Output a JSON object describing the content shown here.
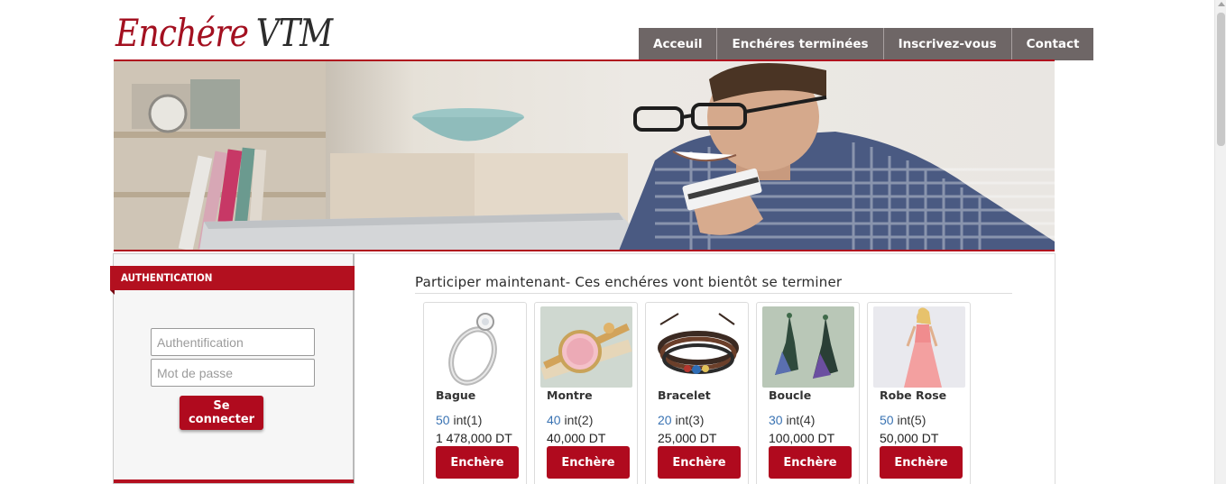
{
  "brand": {
    "logo_part1": "Enchére",
    "logo_part2": "VTM",
    "accent": "#b0101e"
  },
  "nav": {
    "items": [
      {
        "label": "Acceuil"
      },
      {
        "label": "Enchéres terminées"
      },
      {
        "label": "Inscrivez-vous"
      },
      {
        "label": "Contact"
      }
    ]
  },
  "sidebar": {
    "header": "AUTHENTICATION",
    "login_placeholder": "Authentification",
    "password_placeholder": "Mot de passe",
    "submit_label": "Se connecter"
  },
  "main": {
    "title": "Participer maintenant- Ces enchéres vont bientôt se terminer",
    "products": [
      {
        "name": "Bague",
        "int_count": "50",
        "int_label": "int(1)",
        "price": "1 478,000 DT",
        "button": "Enchère"
      },
      {
        "name": "Montre",
        "int_count": "40",
        "int_label": "int(2)",
        "price": "40,000 DT",
        "button": "Enchère"
      },
      {
        "name": "Bracelet",
        "int_count": "20",
        "int_label": "int(3)",
        "price": "25,000 DT",
        "button": "Enchère"
      },
      {
        "name": "Boucle",
        "int_count": "30",
        "int_label": "int(4)",
        "price": "100,000 DT",
        "button": "Enchère"
      },
      {
        "name": "Robe Rose",
        "int_count": "50",
        "int_label": "int(5)",
        "price": "50,000 DT",
        "button": "Enchère"
      }
    ]
  }
}
